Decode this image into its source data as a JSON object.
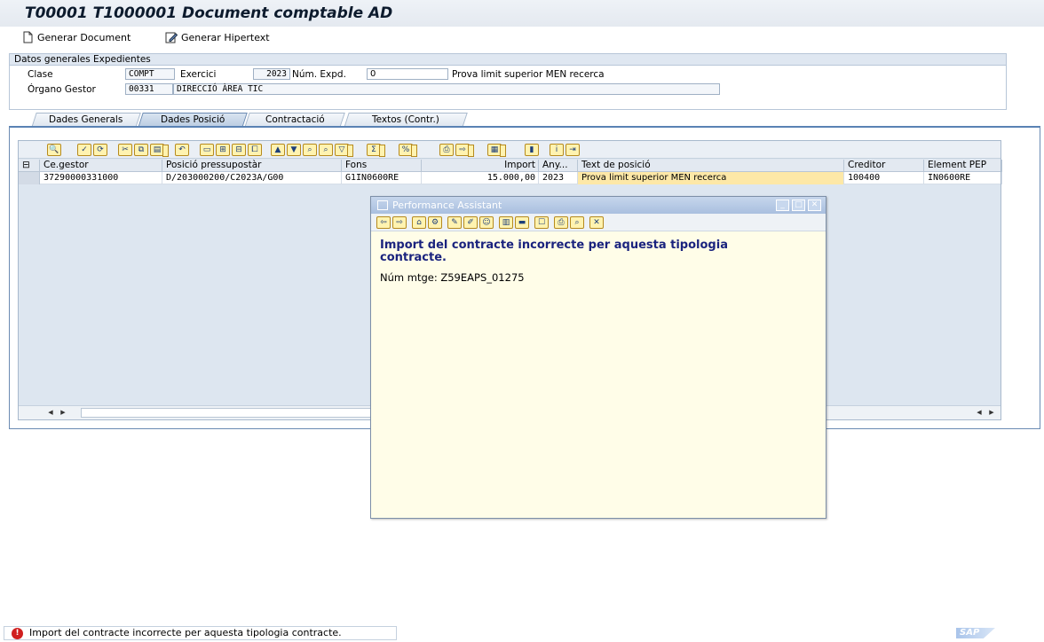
{
  "window": {
    "title": "T00001 T1000001 Document comptable AD"
  },
  "app_toolbar": {
    "generar_document": "Generar Document",
    "generar_hipertext": "Generar Hipertext"
  },
  "header_group": {
    "title": "Datos generales Expedientes",
    "clase_label": "Clase",
    "clase_value": "COMPT",
    "exercici_label": "Exercici",
    "exercici_value": "2023",
    "num_expd_label": "Núm. Expd.",
    "num_expd_value": "0",
    "description": "Prova limit superior MEN recerca",
    "organo_label": "Órgano Gestor",
    "organo_code": "00331",
    "organo_name": "DIRECCIÓ ÀREA TIC"
  },
  "tabs": [
    {
      "label": "Dades Generals",
      "active": false
    },
    {
      "label": "Dades Posició",
      "active": true
    },
    {
      "label": "Contractació",
      "active": false
    },
    {
      "label": "Textos (Contr.)",
      "active": false
    }
  ],
  "grid": {
    "columns": [
      "Ce.gestor",
      "Posició pressupostàr",
      "Fons",
      "Import",
      "Any...",
      "Text de posició",
      "Creditor",
      "Element PEP"
    ],
    "rows": [
      {
        "ce_gestor": "37290000331000",
        "posicio": "D/203000200/C2023A/G00",
        "fons": "G1IN0600RE",
        "import": "15.000,00",
        "any": "2023",
        "text": "Prova limit superior MEN recerca",
        "creditor": "100400",
        "element_pep": "IN0600RE"
      }
    ]
  },
  "perf_assistant": {
    "title": "Performance Assistant",
    "message": "Import del contracte incorrecte per aquesta tipologia contracte.",
    "msg_number": "Núm mtge: Z59EAPS_01275"
  },
  "status": {
    "message": "Import del contracte incorrecte per aquesta tipologia contracte.",
    "type": "error"
  },
  "colors": {
    "title_bg": "#e4e9f0",
    "active_tab": "#b9cbe1",
    "highlight_cell": "#fde8a7",
    "assistant_bg": "#fffde8",
    "error_red": "#d01f1f"
  }
}
